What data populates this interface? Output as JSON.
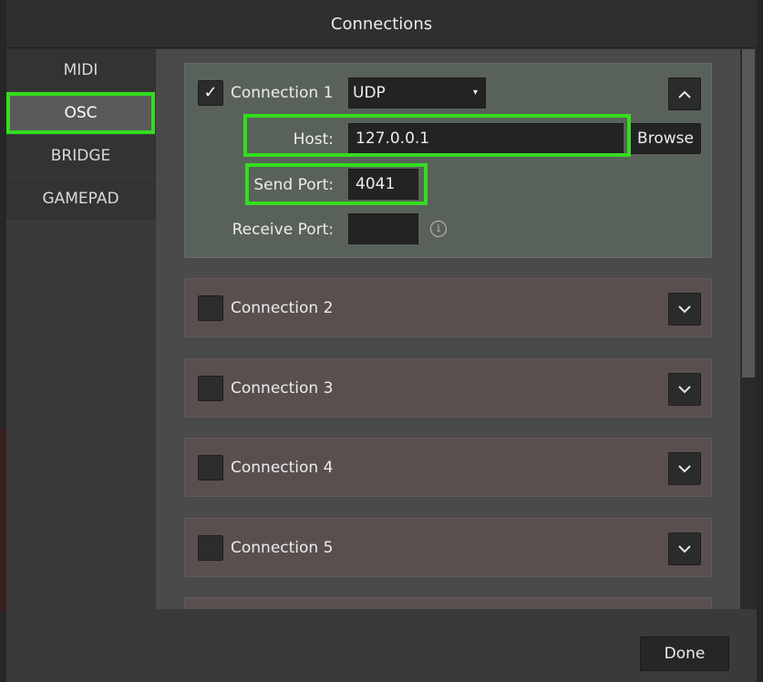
{
  "window": {
    "title": "Connections"
  },
  "sidebar": {
    "items": [
      {
        "label": "MIDI",
        "active": false
      },
      {
        "label": "OSC",
        "active": true
      },
      {
        "label": "BRIDGE",
        "active": false
      },
      {
        "label": "GAMEPAD",
        "active": false
      }
    ]
  },
  "connections": [
    {
      "label": "Connection 1",
      "checked": true,
      "check_glyph": "✓",
      "protocol": "UDP",
      "protocol_arrow": "▾",
      "host_label": "Host:",
      "host_value": "127.0.0.1",
      "browse_label": "Browse",
      "send_port_label": "Send Port:",
      "send_port_value": "4041",
      "receive_port_label": "Receive Port:",
      "receive_port_value": "",
      "info_glyph": "i"
    },
    {
      "label": "Connection 2",
      "checked": false
    },
    {
      "label": "Connection 3",
      "checked": false
    },
    {
      "label": "Connection 4",
      "checked": false
    },
    {
      "label": "Connection 5",
      "checked": false
    }
  ],
  "footer": {
    "done_label": "Done"
  },
  "colors": {
    "highlight": "#33dd1f",
    "expanded_panel": "#59625a",
    "collapsed_panel": "#5a4f4f"
  }
}
